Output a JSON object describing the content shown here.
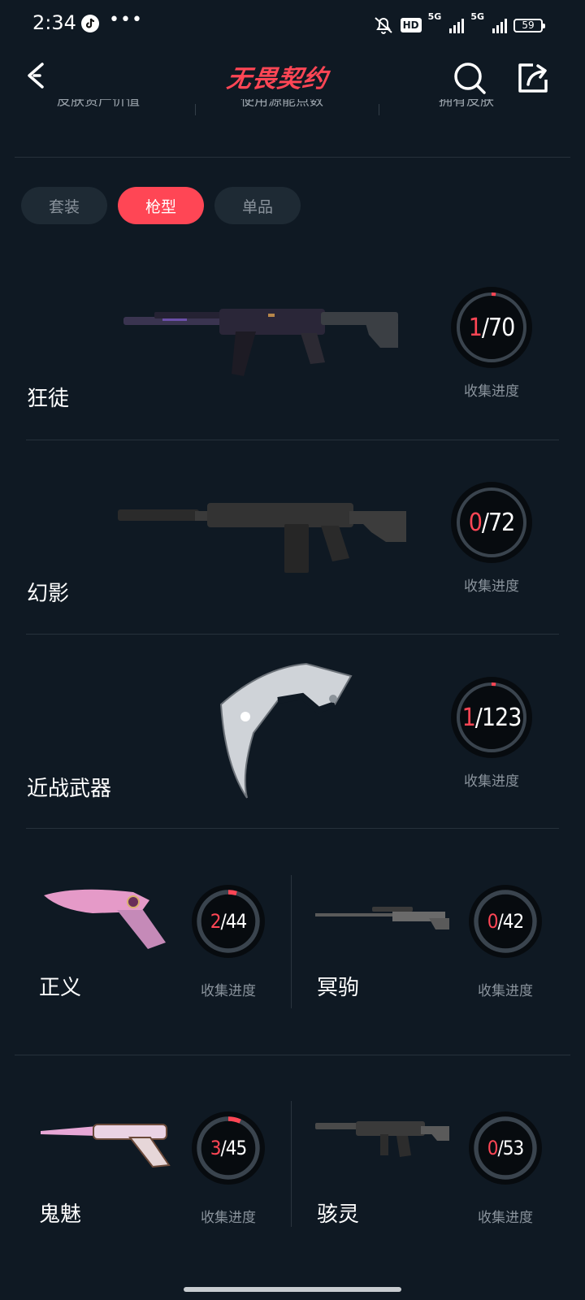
{
  "status_bar": {
    "time": "2:34",
    "dots": "•••",
    "hd": "HD",
    "net1": "5G",
    "net2": "5G",
    "battery": "59"
  },
  "header": {
    "title": "无畏契约",
    "back_icon": "chevron-left-icon",
    "search_icon": "search-icon",
    "share_icon": "share-icon"
  },
  "stats_strip": {
    "labels": [
      "皮肤资产价值",
      "使用源能点数",
      "拥有皮肤"
    ]
  },
  "tabs": [
    {
      "label": "套装",
      "active": false
    },
    {
      "label": "枪型",
      "active": true
    },
    {
      "label": "单品",
      "active": false
    }
  ],
  "progress_label": "收集进度",
  "weapons_full": [
    {
      "name": "狂徒",
      "owned": "1",
      "total": "70",
      "progress": 0.0143
    },
    {
      "name": "幻影",
      "owned": "0",
      "total": "72",
      "progress": 0
    },
    {
      "name": "近战武器",
      "owned": "1",
      "total": "123",
      "progress": 0.0081
    }
  ],
  "weapons_half": [
    {
      "name": "正义",
      "owned": "2",
      "total": "44",
      "progress": 0.0455
    },
    {
      "name": "冥驹",
      "owned": "0",
      "total": "42",
      "progress": 0
    },
    {
      "name": "鬼魅",
      "owned": "3",
      "total": "45",
      "progress": 0.0667
    },
    {
      "name": "骇灵",
      "owned": "0",
      "total": "53",
      "progress": 0
    }
  ],
  "colors": {
    "accent": "#ff4655",
    "background": "#0f1923",
    "ring_track": "#3a444e",
    "muted_text": "#8a939c"
  }
}
